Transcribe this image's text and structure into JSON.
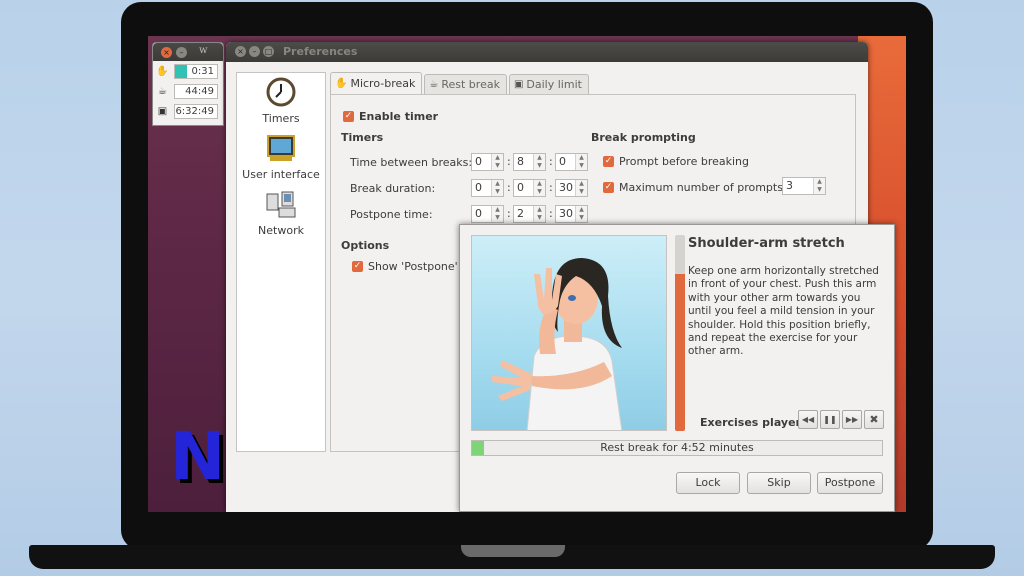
{
  "mini_window": {
    "title_glyph": "w",
    "timers": [
      {
        "icon": "hand-icon",
        "value": "0:31",
        "fill_fraction": 0.28
      },
      {
        "icon": "rest-break-icon",
        "value": "44:49",
        "fill_fraction": 0
      },
      {
        "icon": "daily-limit-icon",
        "value": "6:32:49",
        "fill_fraction": 0
      }
    ]
  },
  "preferences": {
    "title": "Preferences",
    "sidebar": [
      {
        "label": "Timers",
        "icon": "clock-icon"
      },
      {
        "label": "User interface",
        "icon": "monitor-icon"
      },
      {
        "label": "Network",
        "icon": "network-icon"
      }
    ],
    "tabs": [
      {
        "label": "Micro-break",
        "active": true
      },
      {
        "label": "Rest break",
        "active": false
      },
      {
        "label": "Daily limit",
        "active": false
      }
    ],
    "enable_timer": "Enable timer",
    "timers_heading": "Timers",
    "time_between_label": "Time between breaks:",
    "time_between": [
      "0",
      "8",
      "0"
    ],
    "break_duration_label": "Break duration:",
    "break_duration": [
      "0",
      "0",
      "30"
    ],
    "postpone_time_label": "Postpone time:",
    "postpone_time": [
      "0",
      "2",
      "30"
    ],
    "break_prompting_heading": "Break prompting",
    "prompt_before": "Prompt before breaking",
    "max_prompts_label": "Maximum number of prompts:",
    "max_prompts": "3",
    "options_heading": "Options",
    "show_postpone": "Show 'Postpone'"
  },
  "break_dialog": {
    "exercise_title": "Shoulder-arm stretch",
    "exercise_description": "Keep one arm horizontally stretched in front of your chest. Push this arm with your other arm towards you until you feel a mild tension in your shoulder. Hold this position briefly, and repeat the exercise for your other arm.",
    "exercise_progress_fraction": 0.8,
    "player_label": "Exercises player:",
    "progress_text": "Rest break for 4:52 minutes",
    "progress_fraction": 0.03,
    "buttons": {
      "lock": "Lock",
      "skip": "Skip",
      "postpone": "Postpone"
    }
  },
  "logo_letter": "N",
  "colors": {
    "accent": "#e0693e",
    "progress": "#7ed477",
    "timer_fill": "#30c2b3",
    "logo": "#2424d8"
  }
}
